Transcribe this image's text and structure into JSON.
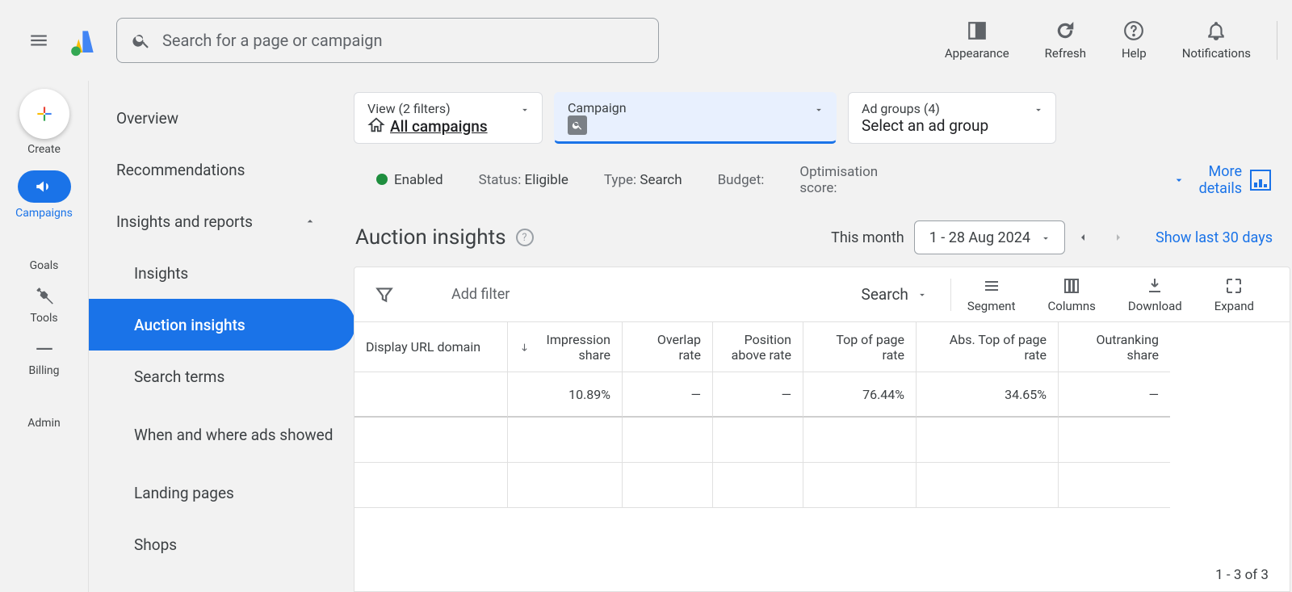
{
  "search_placeholder": "Search for a page or campaign",
  "top_actions": {
    "appearance": "Appearance",
    "refresh": "Refresh",
    "help": "Help",
    "notifications": "Notifications"
  },
  "rail": {
    "create": "Create",
    "campaigns": "Campaigns",
    "goals": "Goals",
    "tools": "Tools",
    "billing": "Billing",
    "admin": "Admin"
  },
  "sidebar": {
    "overview": "Overview",
    "recommendations": "Recommendations",
    "insights_reports": "Insights and reports",
    "insights": "Insights",
    "auction_insights": "Auction insights",
    "search_terms": "Search terms",
    "when_where": "When and where ads showed",
    "landing_pages": "Landing pages",
    "shops": "Shops"
  },
  "crumbs": {
    "view_label": "View (2 filters)",
    "view_value": "All campaigns",
    "campaign_label": "Campaign",
    "adg_label": "Ad groups (4)",
    "adg_value": "Select an ad group"
  },
  "status": {
    "enabled": "Enabled",
    "status_lbl": "Status: ",
    "status_val": "Eligible",
    "type_lbl": "Type: ",
    "type_val": "Search",
    "budget_lbl": "Budget:",
    "opt_lbl": "Optimisation score:",
    "more": "More details"
  },
  "page_title": "Auction insights",
  "date": {
    "label": "This month",
    "range": "1 - 28 Aug 2024",
    "last30": "Show last 30 days"
  },
  "toolbar": {
    "add_filter": "Add filter",
    "search": "Search",
    "segment": "Segment",
    "columns": "Columns",
    "download": "Download",
    "expand": "Expand"
  },
  "table": {
    "headers": {
      "domain": "Display URL domain",
      "imp": "Impression share",
      "overlap": "Overlap rate",
      "pos": "Position above rate",
      "top": "Top of page rate",
      "abs": "Abs. Top of page rate",
      "out": "Outranking share"
    },
    "row0": {
      "domain": "",
      "imp": "10.89%",
      "overlap": "—",
      "pos": "—",
      "top": "76.44%",
      "abs": "34.65%",
      "out": "—"
    }
  },
  "pager": "1 - 3 of 3"
}
